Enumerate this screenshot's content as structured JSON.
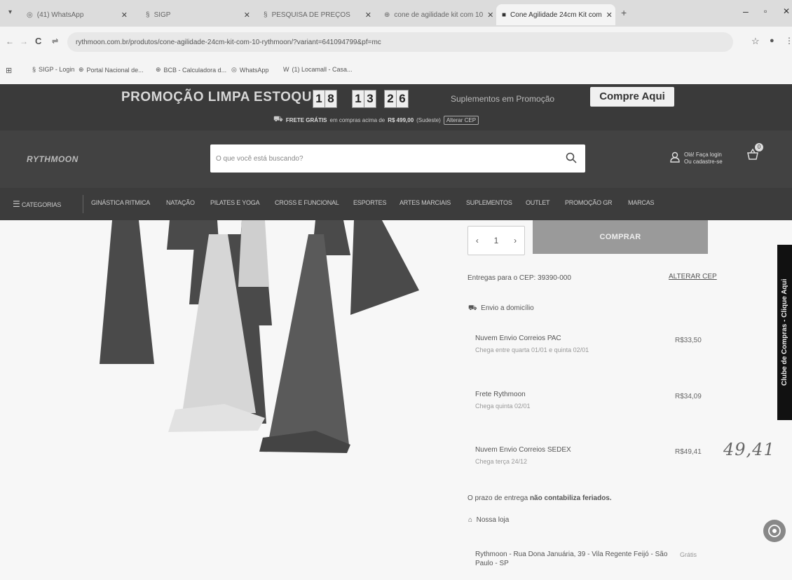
{
  "browser": {
    "tabs": [
      {
        "label": "(41) WhatsApp",
        "active": false
      },
      {
        "label": "SIGP",
        "active": false
      },
      {
        "label": "PESQUISA DE PREÇOS",
        "active": false
      },
      {
        "label": "cone de agilidade kit com 10",
        "active": false
      },
      {
        "label": "Cone Agilidade 24cm Kit com",
        "active": true
      }
    ],
    "url": "rythmoon.com.br/produtos/cone-agilidade-24cm-kit-com-10-rythmoon/?variant=641094799&pf=mc",
    "bookmarks": [
      "SIGP - Login",
      "Portal Nacional de...",
      "BCB - Calculadora d...",
      "WhatsApp",
      "(1) Locamall - Casa..."
    ]
  },
  "promo": {
    "title": "PROMOÇÃO LIMPA ESTOQUE",
    "countdown": [
      "1",
      "8",
      "1",
      "3",
      "2",
      "6"
    ],
    "suplementos": "Suplementos em Promoção",
    "cta": "Compre Aqui",
    "frete_label": "FRETE GRÁTIS",
    "frete_text": "em compras acima de",
    "frete_value": "R$ 499,00",
    "frete_region": "(Sudeste)",
    "alterar": "Alterar CEP"
  },
  "header": {
    "logo": "RYTHMOON",
    "search_placeholder": "O que você está buscando?",
    "login_line1": "Olá! Faça login",
    "login_line2": "Ou cadastre-se",
    "cart_count": "0"
  },
  "nav": [
    "CATEGORIAS",
    "GINÁSTICA RITMICA",
    "NATAÇÃO",
    "PILATES E YOGA",
    "CROSS E FUNCIONAL",
    "ESPORTES",
    "ARTES MARCIAIS",
    "SUPLEMENTOS",
    "OUTLET",
    "PROMOÇÃO GR",
    "MARCAS"
  ],
  "product": {
    "quantity": "1",
    "buy_label": "COMPRAR",
    "cep_text": "Entregas para o CEP: 39390-000",
    "alterar_cep": "ALTERAR CEP",
    "envio_label": "Envio a domicílio",
    "shipping": [
      {
        "name": "Nuvem Envio Correios PAC",
        "note": "Chega entre quarta 01/01 e quinta 02/01",
        "price": "R$33,50"
      },
      {
        "name": "Frete Rythmoon",
        "note": "Chega quinta 02/01",
        "price": "R$34,09"
      },
      {
        "name": "Nuvem Envio Correios SEDEX",
        "note": "Chega terça 24/12",
        "price": "R$49,41"
      }
    ],
    "prazo_prefix": "O prazo de entrega",
    "prazo_bold": "não contabiliza feriados.",
    "loja_label": "Nossa loja",
    "loja_address": "Rythmoon - Rua Dona Januária, 39 - Vila Regente Feijó - São Paulo - SP",
    "loja_price": "Grátis"
  },
  "side_tab": "Clube de Compras - Clique Aqui",
  "handwritten": "49,41"
}
